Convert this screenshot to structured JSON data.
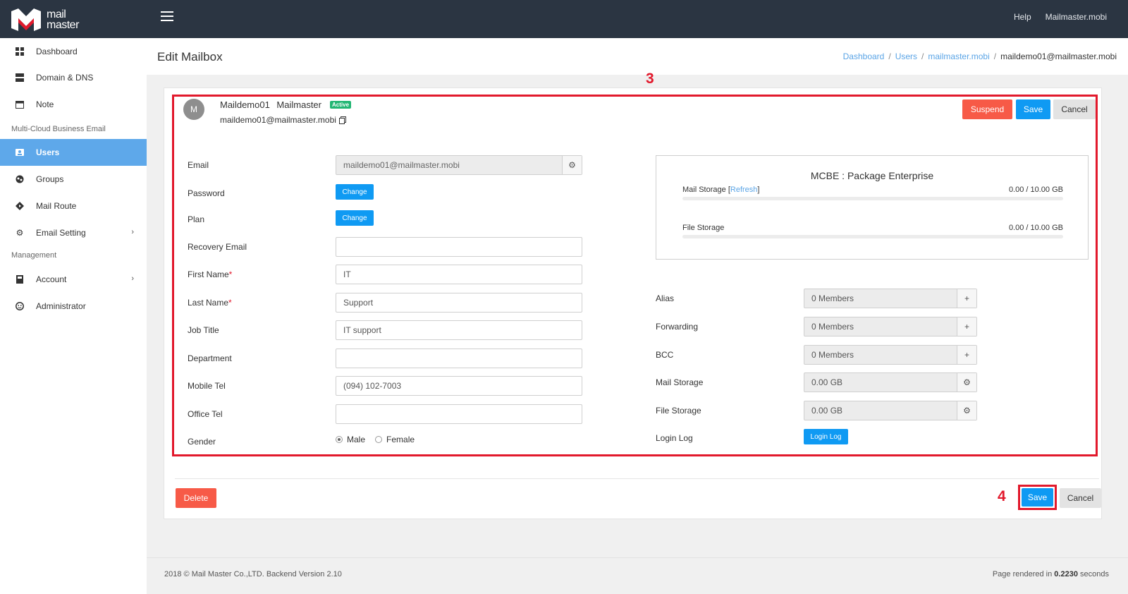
{
  "header": {
    "logo_text_line1": "mail",
    "logo_text_line2": "master",
    "help": "Help",
    "account": "Mailmaster.mobi"
  },
  "sidebar": {
    "items": [
      {
        "label": "Dashboard",
        "icon": "dashboard-icon"
      },
      {
        "label": "Domain & DNS",
        "icon": "server-icon"
      },
      {
        "label": "Note",
        "icon": "calendar-icon"
      },
      {
        "label": "Users",
        "icon": "user-card-icon"
      },
      {
        "label": "Groups",
        "icon": "globe-icon"
      },
      {
        "label": "Mail Route",
        "icon": "route-icon"
      },
      {
        "label": "Email Setting",
        "icon": "gear-icon"
      },
      {
        "label": "Account",
        "icon": "account-book-icon"
      },
      {
        "label": "Administrator",
        "icon": "admin-face-icon"
      }
    ],
    "section1": "Multi-Cloud Business Email",
    "section2": "Management",
    "active": "Users"
  },
  "page": {
    "title": "Edit Mailbox",
    "breadcrumb": [
      "Dashboard",
      "Users",
      "mailmaster.mobi",
      "maildemo01@mailmaster.mobi"
    ]
  },
  "annotations": {
    "box": "3",
    "save": "4"
  },
  "user": {
    "initial": "M",
    "display_name": "Maildemo01 Mailmaster",
    "status": "Active",
    "email": "maildemo01@mailmaster.mobi"
  },
  "actions": {
    "suspend": "Suspend",
    "save": "Save",
    "cancel": "Cancel",
    "delete": "Delete"
  },
  "form": {
    "email_label": "Email",
    "email_value": "maildemo01@mailmaster.mobi",
    "password_label": "Password",
    "plan_label": "Plan",
    "change": "Change",
    "recovery_label": "Recovery Email",
    "recovery_value": "",
    "first_name_label": "First Name",
    "first_name_value": "IT",
    "last_name_label": "Last Name",
    "last_name_value": "Support",
    "job_title_label": "Job Title",
    "job_title_value": "IT support",
    "department_label": "Department",
    "department_value": "",
    "mobile_label": "Mobile Tel",
    "mobile_value": "(094) 102-7003",
    "office_label": "Office Tel",
    "office_value": "",
    "gender_label": "Gender",
    "gender_male": "Male",
    "gender_female": "Female",
    "gender_selected": "Male",
    "required_mark": "*"
  },
  "package": {
    "title": "MCBE : Package Enterprise",
    "mail_storage_label": "Mail Storage",
    "refresh": "Refresh",
    "mail_storage_value": "0.00 / 10.00 GB",
    "file_storage_label": "File Storage",
    "file_storage_value": "0.00 / 10.00 GB",
    "mail_storage_used_fraction": 0,
    "file_storage_used_fraction": 0
  },
  "right_form": {
    "alias_label": "Alias",
    "alias_value": "0 Members",
    "forwarding_label": "Forwarding",
    "forwarding_value": "0 Members",
    "bcc_label": "BCC",
    "bcc_value": "0 Members",
    "mail_storage_label": "Mail Storage",
    "mail_storage_value": "0.00 GB",
    "file_storage_label": "File Storage",
    "file_storage_value": "0.00 GB",
    "login_log_label": "Login Log",
    "login_log_button": "Login Log"
  },
  "footer": {
    "left": "2018 © Mail Master Co.,LTD. Backend Version 2.10",
    "right_prefix": "Page rendered in",
    "right_time": "0.2230",
    "right_suffix": "seconds"
  },
  "colors": {
    "topbar": "#2b3542",
    "active_nav": "#5ea8ea",
    "primary": "#0f9af3",
    "danger": "#f75a47",
    "badge": "#22b673",
    "annotation": "#e2192c"
  }
}
